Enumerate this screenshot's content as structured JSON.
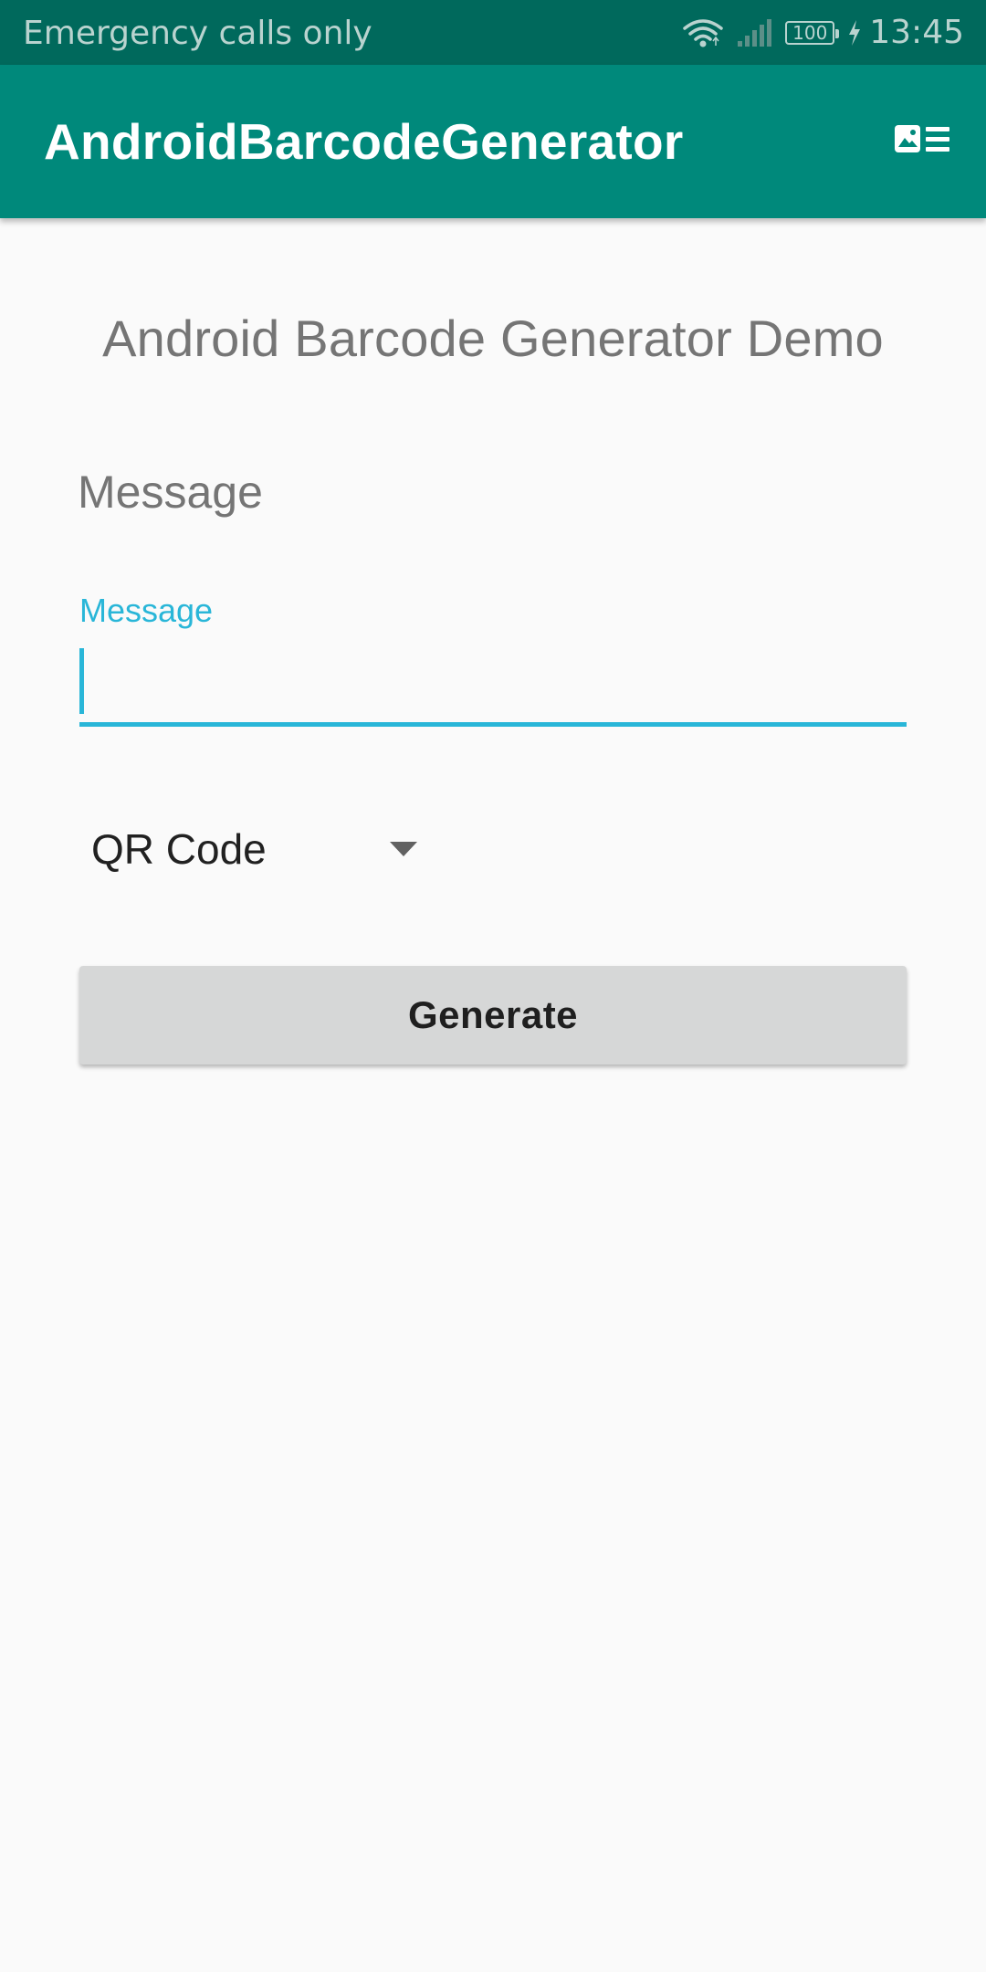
{
  "status_bar": {
    "carrier_text": "Emergency calls only",
    "battery_level": "100",
    "time": "13:45",
    "icons": [
      "wifi-icon",
      "signal-icon",
      "battery-icon",
      "charging-icon"
    ]
  },
  "app_bar": {
    "title": "AndroidBarcodeGenerator",
    "action_icon": "image-list-icon"
  },
  "main": {
    "heading": "Android Barcode Generator Demo",
    "message_section_label": "Message",
    "message_field": {
      "floating_label": "Message",
      "value": "",
      "placeholder": ""
    },
    "barcode_type_spinner": {
      "selected": "QR Code"
    },
    "generate_button_label": "Generate"
  },
  "colors": {
    "status_bar": "#00695c",
    "app_bar": "#00897b",
    "accent": "#29b6d8",
    "background": "#fafafa",
    "button": "#d6d7d7"
  }
}
